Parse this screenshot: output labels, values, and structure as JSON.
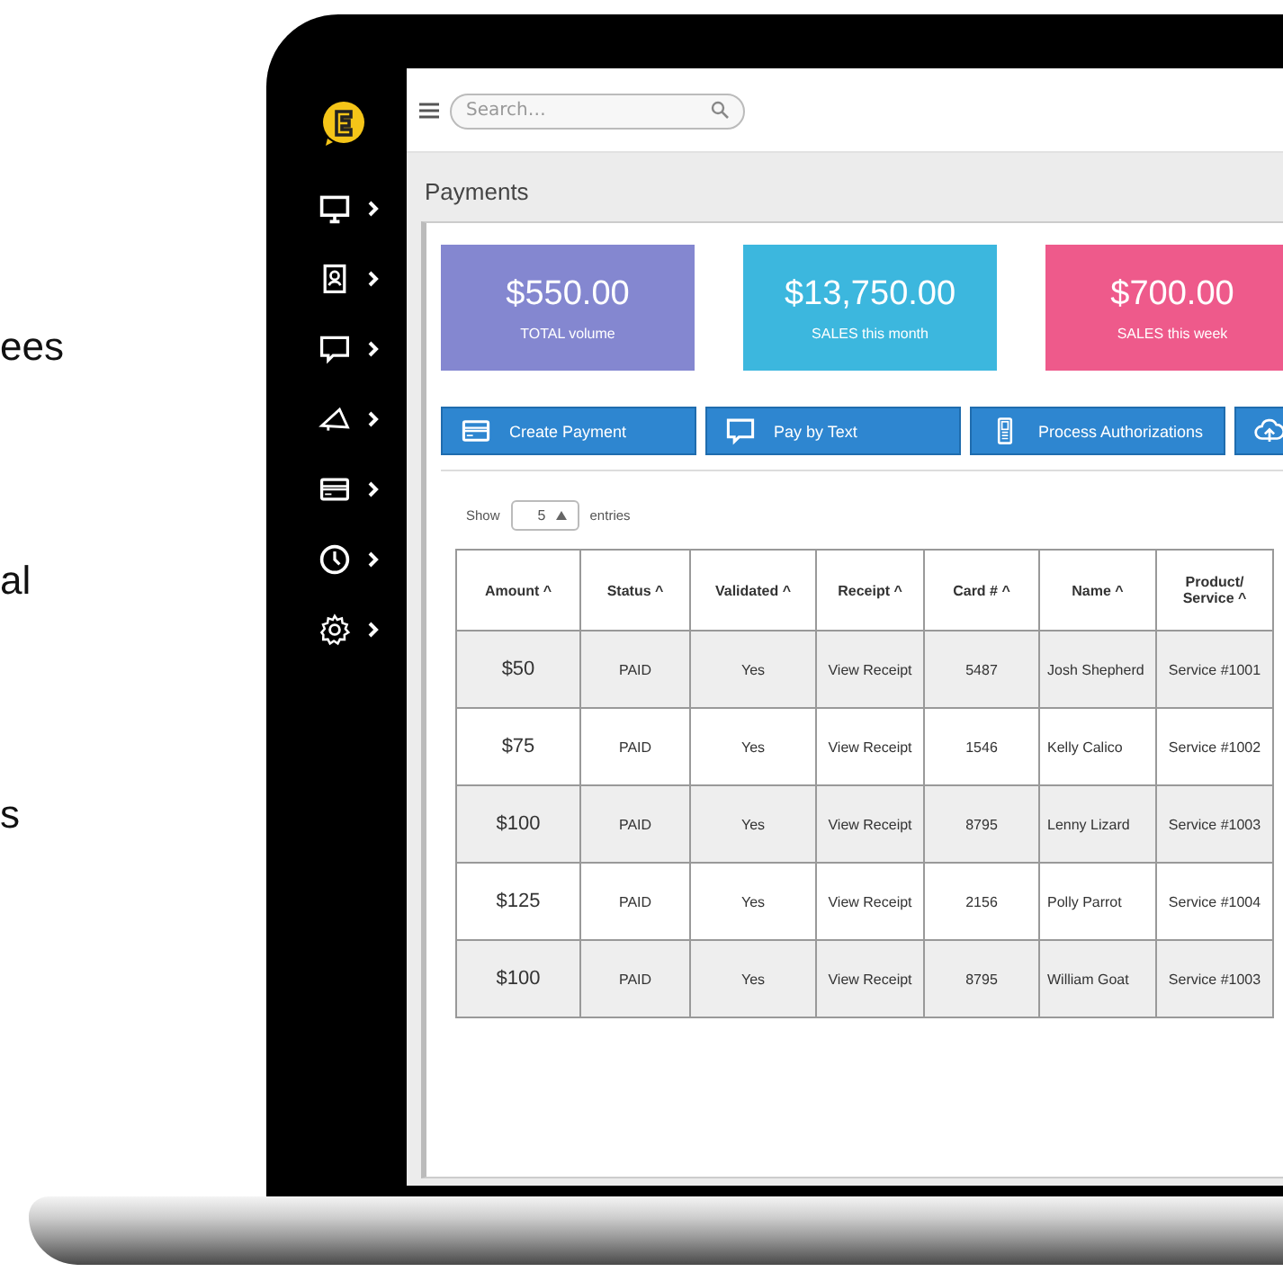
{
  "side_text": [
    "ees",
    "al",
    "s"
  ],
  "sidebar": {
    "items": [
      {
        "kind": "monitor"
      },
      {
        "kind": "contact"
      },
      {
        "kind": "chat"
      },
      {
        "kind": "megaphone"
      },
      {
        "kind": "card"
      },
      {
        "kind": "clock"
      },
      {
        "kind": "gear"
      }
    ]
  },
  "search": {
    "placeholder": "Search…"
  },
  "page_title": "Payments",
  "stats": [
    {
      "value": "$550.00",
      "label": "TOTAL volume",
      "color": "#8487d0"
    },
    {
      "value": "$13,750.00",
      "label": "SALES this month",
      "color": "#3cb7de"
    },
    {
      "value": "$700.00",
      "label": "SALES this week",
      "color": "#ee5a8b"
    }
  ],
  "actions": [
    {
      "kind": "card",
      "label": "Create Payment"
    },
    {
      "kind": "chat",
      "label": "Pay by Text"
    },
    {
      "kind": "phone",
      "label": "Process Authorizations"
    },
    {
      "kind": "upload"
    }
  ],
  "entries": {
    "prefix": "Show",
    "value": "5",
    "suffix": "entries"
  },
  "table": {
    "columns": [
      "Amount ^",
      "Status ^",
      "Validated ^",
      "Receipt ^",
      "Card # ^",
      "Name ^",
      "Product/ Service ^"
    ],
    "rows": [
      [
        "$50",
        "PAID",
        "Yes",
        "View Receipt",
        "5487",
        "Josh Shepherd",
        "Service #1001"
      ],
      [
        "$75",
        "PAID",
        "Yes",
        "View Receipt",
        "1546",
        "Kelly Calico",
        "Service #1002"
      ],
      [
        "$100",
        "PAID",
        "Yes",
        "View Receipt",
        "8795",
        "Lenny Lizard",
        "Service #1003"
      ],
      [
        "$125",
        "PAID",
        "Yes",
        "View Receipt",
        "2156",
        "Polly Parrot",
        "Service #1004"
      ],
      [
        "$100",
        "PAID",
        "Yes",
        "View Receipt",
        "8795",
        "William Goat",
        "Service #1003"
      ]
    ]
  }
}
